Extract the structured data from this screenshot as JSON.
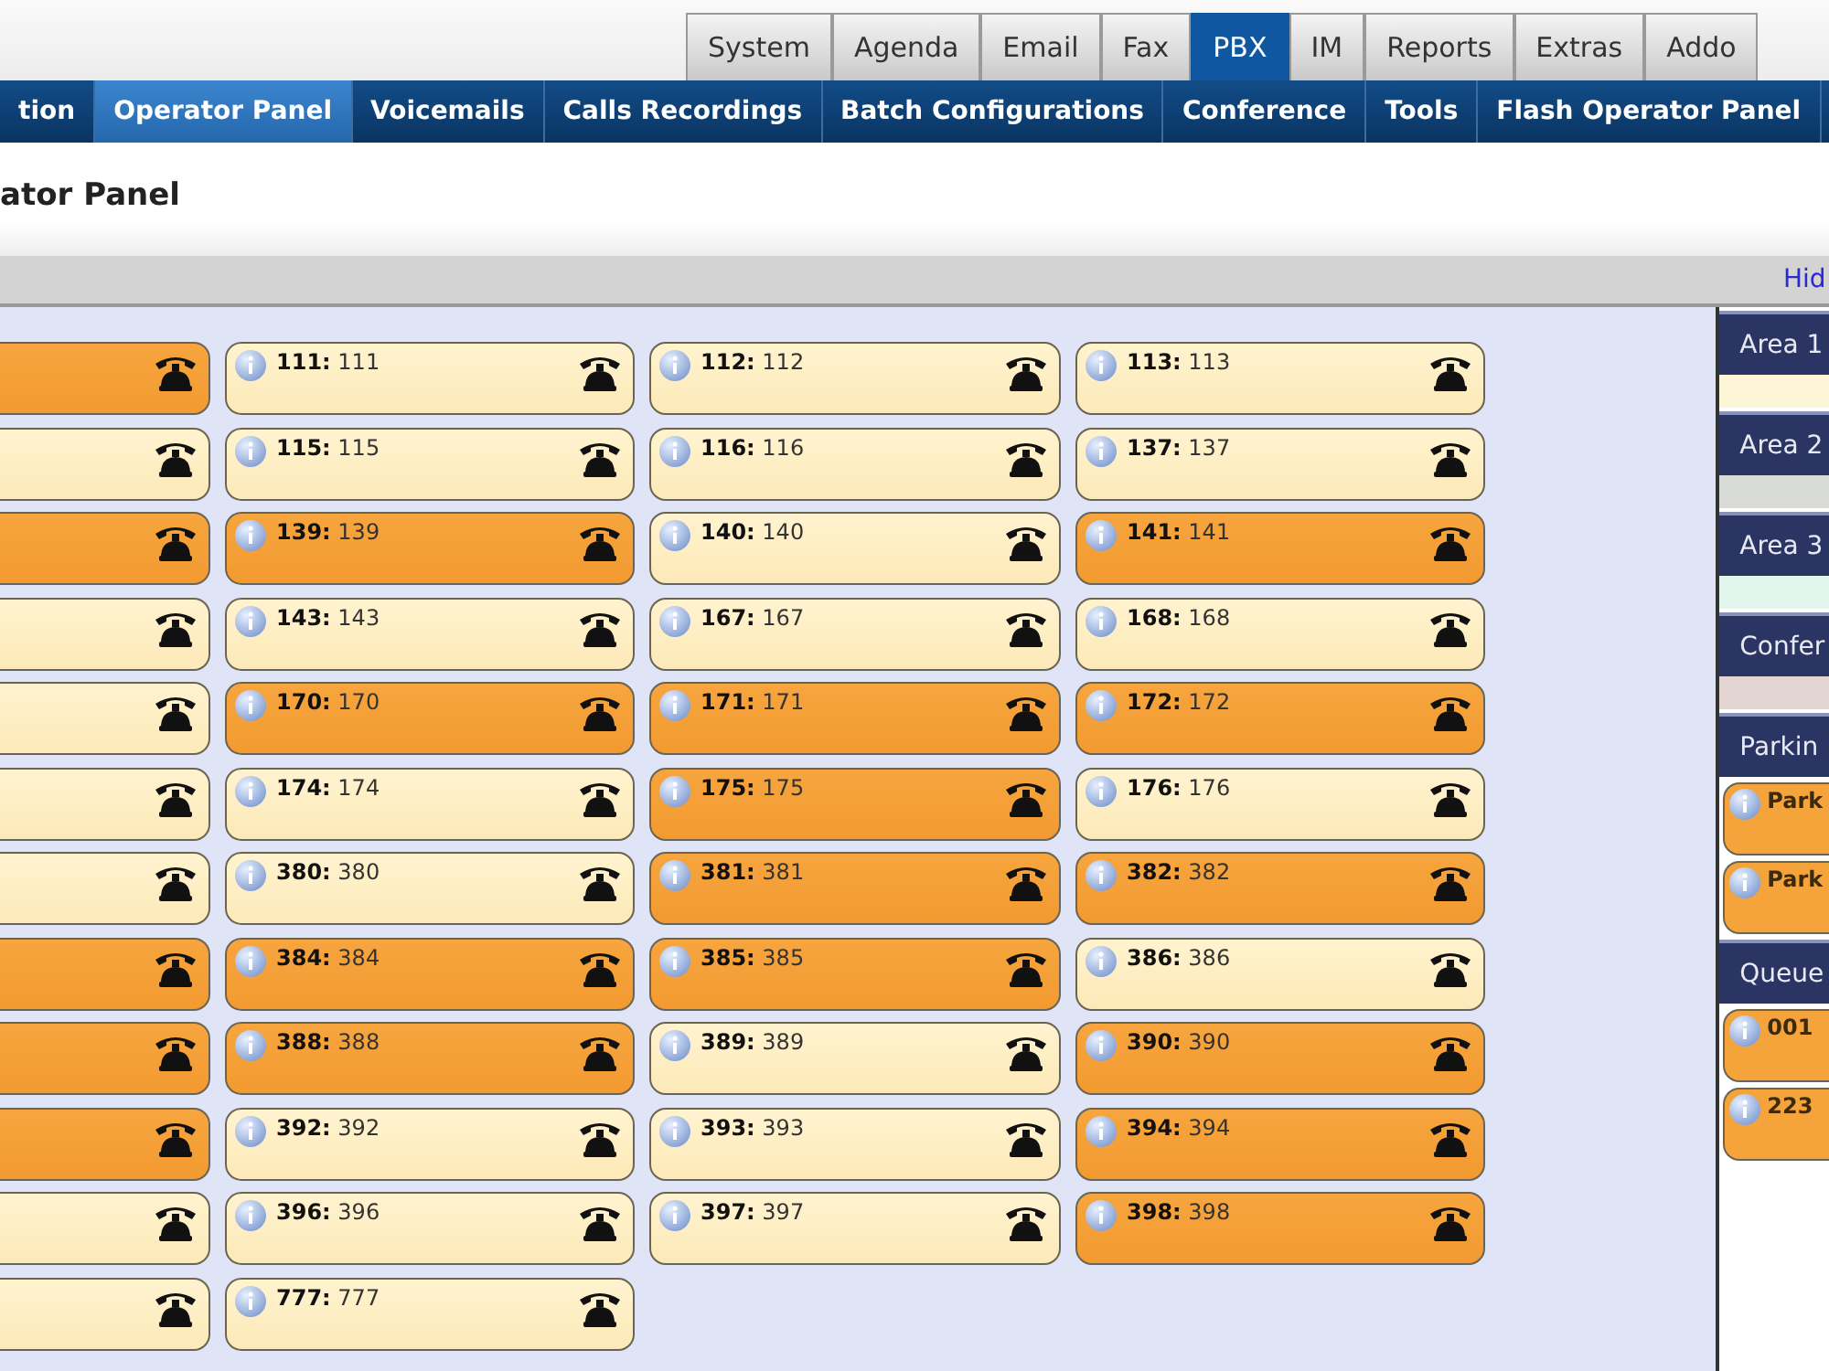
{
  "top_tabs": [
    {
      "label": "System",
      "selected": false
    },
    {
      "label": "Agenda",
      "selected": false
    },
    {
      "label": "Email",
      "selected": false
    },
    {
      "label": "Fax",
      "selected": false
    },
    {
      "label": "PBX",
      "selected": true
    },
    {
      "label": "IM",
      "selected": false
    },
    {
      "label": "Reports",
      "selected": false
    },
    {
      "label": "Extras",
      "selected": false
    },
    {
      "label": "Addo",
      "selected": false
    }
  ],
  "sub_nav": [
    {
      "label": "tion",
      "selected": false
    },
    {
      "label": "Operator Panel",
      "selected": true
    },
    {
      "label": "Voicemails",
      "selected": false
    },
    {
      "label": "Calls Recordings",
      "selected": false
    },
    {
      "label": "Batch Configurations",
      "selected": false
    },
    {
      "label": "Conference",
      "selected": false
    },
    {
      "label": "Tools",
      "selected": false
    },
    {
      "label": "Flash Operator Panel",
      "selected": false
    }
  ],
  "page_title": "ator Panel",
  "toolbar": {
    "hide_link": "Hid"
  },
  "extension_rows": [
    {
      "cells": [
        {
          "kind": "cut",
          "busy": true
        },
        {
          "kind": "full",
          "label": "**111:** 111",
          "busy": false
        },
        {
          "kind": "full",
          "label": "**112:** 112",
          "busy": false
        },
        {
          "kind": "full",
          "label": "**113:** 113",
          "busy": false
        }
      ]
    },
    {
      "cells": [
        {
          "kind": "cut",
          "busy": false
        },
        {
          "kind": "full",
          "label": "**115:** 115",
          "busy": false
        },
        {
          "kind": "full",
          "label": "**116:** 116",
          "busy": false
        },
        {
          "kind": "full",
          "label": "**137:** 137",
          "busy": false
        }
      ]
    },
    {
      "cells": [
        {
          "kind": "cut",
          "busy": true
        },
        {
          "kind": "full",
          "label": "**139:** 139",
          "busy": true
        },
        {
          "kind": "full",
          "label": "**140:** 140",
          "busy": false
        },
        {
          "kind": "full",
          "label": "**141:** 141",
          "busy": true
        }
      ]
    },
    {
      "cells": [
        {
          "kind": "cut",
          "busy": false
        },
        {
          "kind": "full",
          "label": "**143:** 143",
          "busy": false
        },
        {
          "kind": "full",
          "label": "**167:** 167",
          "busy": false
        },
        {
          "kind": "full",
          "label": "**168:** 168",
          "busy": false
        }
      ]
    },
    {
      "cells": [
        {
          "kind": "cut",
          "busy": false
        },
        {
          "kind": "full",
          "label": "**170:** 170",
          "busy": true
        },
        {
          "kind": "full",
          "label": "**171:** 171",
          "busy": true
        },
        {
          "kind": "full",
          "label": "**172:** 172",
          "busy": true
        }
      ]
    },
    {
      "cells": [
        {
          "kind": "cut",
          "busy": false
        },
        {
          "kind": "full",
          "label": "**174:** 174",
          "busy": false
        },
        {
          "kind": "full",
          "label": "**175:** 175",
          "busy": true
        },
        {
          "kind": "full",
          "label": "**176:** 176",
          "busy": false
        }
      ]
    },
    {
      "cells": [
        {
          "kind": "cut",
          "busy": false
        },
        {
          "kind": "full",
          "label": "**380:** 380",
          "busy": false
        },
        {
          "kind": "full",
          "label": "**381:** 381",
          "busy": true
        },
        {
          "kind": "full",
          "label": "**382:** 382",
          "busy": true
        }
      ]
    },
    {
      "cells": [
        {
          "kind": "cut",
          "busy": true
        },
        {
          "kind": "full",
          "label": "**384:** 384",
          "busy": true
        },
        {
          "kind": "full",
          "label": "**385:** 385",
          "busy": true
        },
        {
          "kind": "full",
          "label": "**386:** 386",
          "busy": false
        }
      ]
    },
    {
      "cells": [
        {
          "kind": "cut",
          "busy": true
        },
        {
          "kind": "full",
          "label": "**388:** 388",
          "busy": true
        },
        {
          "kind": "full",
          "label": "**389:** 389",
          "busy": false
        },
        {
          "kind": "full",
          "label": "**390:** 390",
          "busy": true
        }
      ]
    },
    {
      "cells": [
        {
          "kind": "cut",
          "busy": true
        },
        {
          "kind": "full",
          "label": "**392:** 392",
          "busy": false
        },
        {
          "kind": "full",
          "label": "**393:** 393",
          "busy": false
        },
        {
          "kind": "full",
          "label": "**394:** 394",
          "busy": true
        }
      ]
    },
    {
      "cells": [
        {
          "kind": "cut",
          "busy": false
        },
        {
          "kind": "full",
          "label": "**396:** 396",
          "busy": false
        },
        {
          "kind": "full",
          "label": "**397:** 397",
          "busy": false
        },
        {
          "kind": "full",
          "label": "**398:** 398",
          "busy": true
        }
      ]
    },
    {
      "cells": [
        {
          "kind": "cut",
          "busy": false
        },
        {
          "kind": "full",
          "label": "**777:** 777",
          "busy": false
        }
      ]
    }
  ],
  "side_panel": [
    {
      "title": "Area 1",
      "color": "#fdf6d6"
    },
    {
      "title": "Area 2",
      "color": "#d9dcd6"
    },
    {
      "title": "Area 3",
      "color": "#e2f6ee"
    },
    {
      "title": "Confer",
      "color": "#e3d6d2"
    },
    {
      "title": "Parkin",
      "items": [
        {
          "label": "Park"
        },
        {
          "label": "Park"
        }
      ]
    },
    {
      "title": "Queue",
      "items": [
        {
          "label": "001"
        },
        {
          "label": "223"
        }
      ]
    }
  ]
}
